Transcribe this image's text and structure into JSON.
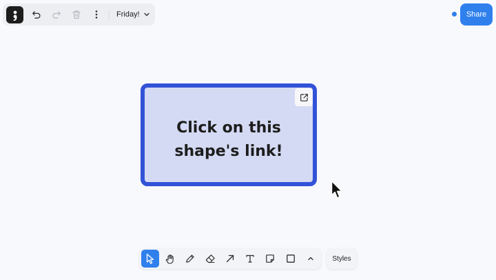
{
  "topbar": {
    "menu_icon": "semicolon-menu-icon",
    "undo_icon": "undo-icon",
    "redo_icon": "redo-icon",
    "delete_icon": "trash-icon",
    "more_icon": "more-vertical-icon",
    "page_name": "Friday!",
    "page_chevron_icon": "chevron-down-icon"
  },
  "share": {
    "label": "Share",
    "presence_color": "#2f80ed"
  },
  "canvas": {
    "shape": {
      "text": "Click on this shape's link!",
      "stroke_color": "#3252d7",
      "fill_color": "#d4daf3",
      "link_icon": "external-link-icon"
    },
    "cursor_icon": "mouse-pointer-icon"
  },
  "toolbar": {
    "tools": [
      {
        "name": "select",
        "icon": "pointer-icon",
        "active": true
      },
      {
        "name": "hand",
        "icon": "hand-icon",
        "active": false
      },
      {
        "name": "draw",
        "icon": "pencil-icon",
        "active": false
      },
      {
        "name": "eraser",
        "icon": "eraser-icon",
        "active": false
      },
      {
        "name": "arrow",
        "icon": "arrow-icon",
        "active": false
      },
      {
        "name": "text",
        "icon": "text-icon",
        "active": false
      },
      {
        "name": "note",
        "icon": "sticky-note-icon",
        "active": false
      },
      {
        "name": "rectangle",
        "icon": "rectangle-icon",
        "active": false
      },
      {
        "name": "more",
        "icon": "chevron-up-icon",
        "active": false
      }
    ],
    "styles_label": "Styles"
  },
  "colors": {
    "accent": "#2f80ed",
    "background": "#f8f9fc"
  }
}
